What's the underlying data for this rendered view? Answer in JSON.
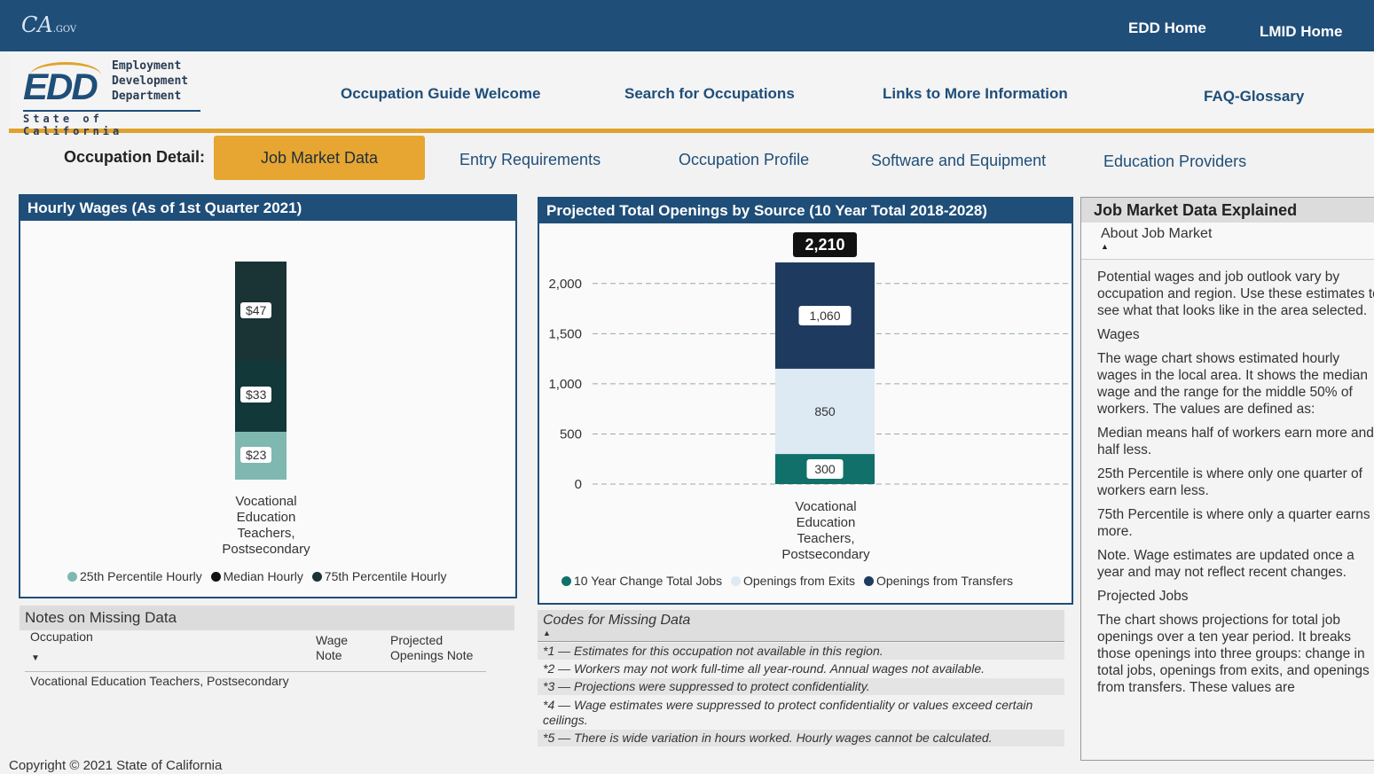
{
  "top": {
    "cagov": "CA",
    "cagov_suffix": ".GOV",
    "edd_home": "EDD Home",
    "lmid_home": "LMID Home"
  },
  "logo": {
    "abbr": "EDD",
    "line1": "Employment",
    "line2": "Development",
    "line3": "Department",
    "state": "State of California"
  },
  "nav": [
    "Occupation Guide Welcome",
    "Search for Occupations",
    "Links to More Information",
    "FAQ-Glossary"
  ],
  "detail": {
    "label": "Occupation Detail:",
    "tabs": [
      "Job Market Data",
      "Entry Requirements",
      "Occupation Profile",
      "Software and Equipment",
      "Education Providers"
    ],
    "active_tab": "Job Market Data"
  },
  "wages": {
    "title": "Hourly Wages (As of 1st Quarter 2021)",
    "category_lines": [
      "Vocational",
      "Education",
      "Teachers,",
      "Postsecondary"
    ],
    "legend": [
      "25th Percentile Hourly",
      "Median Hourly",
      "75th Percentile Hourly"
    ]
  },
  "openings": {
    "title": "Projected Total Openings by Source (10 Year Total 2018-2028)",
    "category_lines": [
      "Vocational",
      "Education",
      "Teachers,",
      "Postsecondary"
    ],
    "legend": [
      "10 Year Change Total Jobs",
      "Openings from Exits",
      "Openings from Transfers"
    ]
  },
  "chart_data": [
    {
      "type": "bar",
      "title": "Hourly Wages (As of 1st Quarter 2021)",
      "categories": [
        "Vocational Education Teachers, Postsecondary"
      ],
      "series": [
        {
          "name": "25th Percentile Hourly",
          "values": [
            23
          ],
          "label": "$23",
          "color": "#7fb8b0"
        },
        {
          "name": "Median Hourly",
          "values": [
            33
          ],
          "label": "$33",
          "color": "#12383a"
        },
        {
          "name": "75th Percentile Hourly",
          "values": [
            47
          ],
          "label": "$47",
          "color": "#1a3335"
        }
      ],
      "ylim": [
        0,
        50
      ],
      "legend": "bottom"
    },
    {
      "type": "bar",
      "stacked": true,
      "title": "Projected Total Openings by Source (10 Year Total 2018-2028)",
      "categories": [
        "Vocational Education Teachers, Postsecondary"
      ],
      "series": [
        {
          "name": "10 Year Change Total Jobs",
          "values": [
            300
          ],
          "label": "300",
          "color": "#12706a"
        },
        {
          "name": "Openings from Exits",
          "values": [
            850
          ],
          "label": "850",
          "color": "#dde9f3"
        },
        {
          "name": "Openings from Transfers",
          "values": [
            1060
          ],
          "label": "1,060",
          "color": "#1f3a5f"
        }
      ],
      "total": 2210,
      "total_label": "2,210",
      "yticks": [
        0,
        500,
        1000,
        1500,
        2000
      ],
      "ytick_labels": [
        "0",
        "500",
        "1,000",
        "1,500",
        "2,000"
      ],
      "ylim": [
        0,
        2210
      ],
      "grid": true,
      "legend": "bottom"
    }
  ],
  "notes": {
    "title": "Notes on Missing Data",
    "col_occupation": "Occupation",
    "col_wage_1": "Wage",
    "col_wage_2": "Note",
    "col_proj_1": "Projected",
    "col_proj_2": "Openings Note",
    "row_occupation": "Vocational Education Teachers, Postsecondary"
  },
  "codes": {
    "title": "Codes for Missing Data",
    "rows": [
      "*1 — Estimates for this occupation not available in this region.",
      "*2 — Workers may not work full-time all year-round. Annual wages not available.",
      "*3 — Projections were suppressed to protect confidentiality.",
      "*4 — Wage estimates were suppressed to protect confidentiality or values exceed certain ceilings.",
      "*5 — There is wide variation in hours worked. Hourly wages cannot be calculated."
    ]
  },
  "explained": {
    "title": "Job Market Data Explained",
    "about": "About Job Market",
    "p1": "Potential wages and job outlook vary by occupation and region. Use these estimates to see what that looks like in the area selected.",
    "h_wages": "Wages",
    "p2": "The wage chart shows estimated hourly wages in the local area. It shows the median wage and the range for the middle 50% of workers. The values are defined as:",
    "p3": "Median means half of workers earn more and half less.",
    "p4": "25th Percentile is where only one quarter of workers earn less.",
    "p5": "75th Percentile is where only a quarter earns more.",
    "p6": "Note. Wage estimates are updated once a year and may not reflect recent changes.",
    "h_jobs": "Projected Jobs",
    "p7": "The chart shows projections for total job openings over a ten year period. It breaks those openings into three groups: change in total jobs, openings from exits, and openings from transfers. These values are"
  },
  "footer": {
    "copyright": "Copyright © 2021 State of California"
  }
}
